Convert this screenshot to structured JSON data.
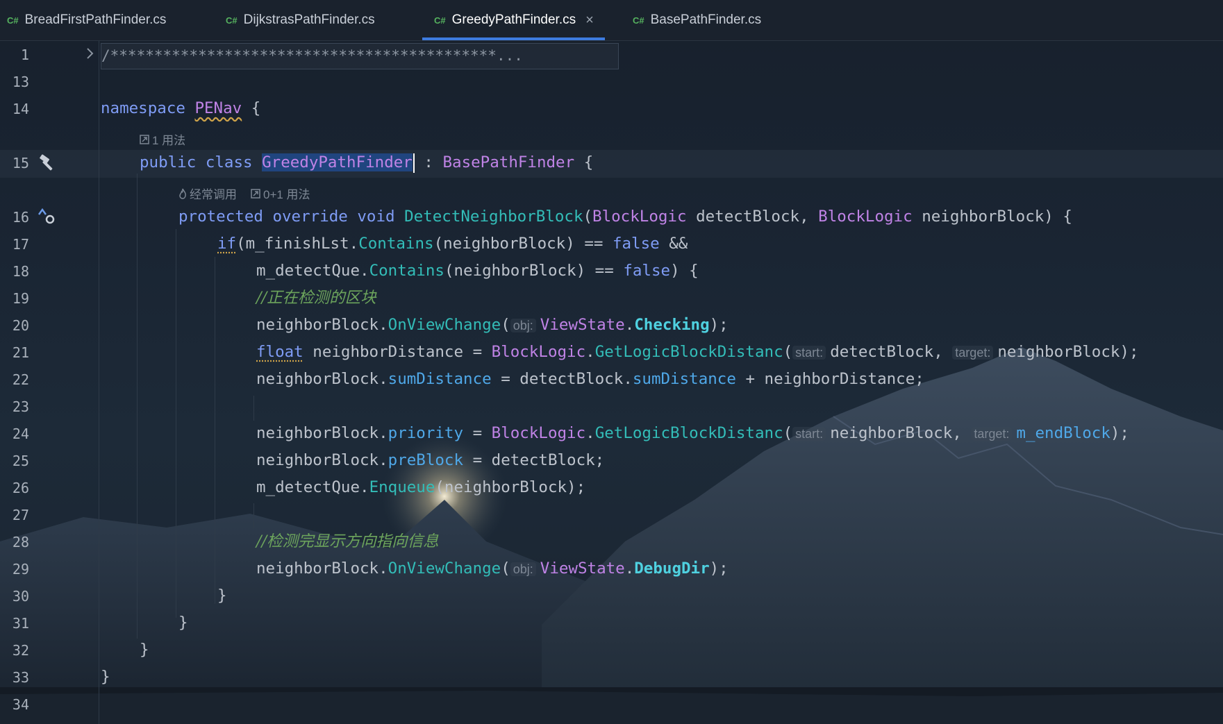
{
  "tabs": [
    {
      "lang": "C#",
      "name": "BreadFirstPathFinder.cs",
      "active": false
    },
    {
      "lang": "C#",
      "name": "DijkstrasPathFinder.cs",
      "active": false
    },
    {
      "lang": "C#",
      "name": "GreedyPathFinder.cs",
      "active": true,
      "close": "×"
    },
    {
      "lang": "C#",
      "name": "BasePathFinder.cs",
      "active": false
    }
  ],
  "line_numbers": [
    "1",
    "13",
    "14",
    "15",
    "16",
    "17",
    "18",
    "19",
    "20",
    "21",
    "22",
    "23",
    "24",
    "25",
    "26",
    "27",
    "28",
    "29",
    "30",
    "31",
    "32",
    "33",
    "34"
  ],
  "folded_header": "/********************************************...",
  "lenses": {
    "class_usage": "1 用法",
    "method_hot": "经常调用",
    "method_usage": "0+1 用法"
  },
  "code": {
    "l14_kw": "namespace",
    "l14_ns": "PENav",
    "l14_brace": "{",
    "l15_kw": "public class",
    "l15_cls": "GreedyPathFinder",
    "l15_colon": ":",
    "l15_base": "BasePathFinder",
    "l15_brace": "{",
    "l16_kw": "protected override void",
    "l16_fn": "DetectNeighborBlock",
    "l16_p1t": "BlockLogic",
    "l16_p1": "detectBlock,",
    "l16_p2t": "BlockLogic",
    "l16_p2": "neighborBlock) {",
    "l17_if": "if",
    "l17_a": "(m_finishLst.",
    "l17_fn": "Contains",
    "l17_b": "(neighborBlock) ==",
    "l17_false": "false",
    "l17_c": "&&",
    "l18_a": "m_detectQue.",
    "l18_fn": "Contains",
    "l18_b": "(neighborBlock) ==",
    "l18_false": "false",
    "l18_c": ") {",
    "l19_com": "//正在检测的区块",
    "l20_a": "neighborBlock.",
    "l20_fn": "OnViewChange",
    "l20_hint": "obj:",
    "l20_t": "ViewState",
    "l20_v": "Checking",
    "l20_end": ");",
    "l21_kw": "float",
    "l21_a": "neighborDistance =",
    "l21_t": "BlockLogic",
    "l21_fn": "GetLogicBlockDistanc",
    "l21_h1": "start:",
    "l21_p1": "detectBlock,",
    "l21_h2": "target:",
    "l21_p2": "neighborBlock);",
    "l22_a": "neighborBlock.",
    "l22_f": "sumDistance",
    "l22_b": "= detectBlock.",
    "l22_f2": "sumDistance",
    "l22_c": "+ neighborDistance;",
    "l24_a": "neighborBlock.",
    "l24_f": "priority",
    "l24_b": "=",
    "l24_t": "BlockLogic",
    "l24_fn": "GetLogicBlockDistanc",
    "l24_h1": "start:",
    "l24_p1": "neighborBlock,",
    "l24_h2": "target:",
    "l24_p2": "m_endBlock",
    "l24_end": ");",
    "l25_a": "neighborBlock.",
    "l25_f": "preBlock",
    "l25_b": "= detectBlock;",
    "l26_a": "m_detectQue.",
    "l26_fn": "Enqueue",
    "l26_b": "(neighborBlock);",
    "l28_com": "//检测完显示方向指向信息",
    "l29_a": "neighborBlock.",
    "l29_fn": "OnViewChange",
    "l29_hint": "obj:",
    "l29_t": "ViewState",
    "l29_v": "DebugDir",
    "l29_end": ");",
    "l30": "}",
    "l31": "}",
    "l32": "}",
    "l33": "}"
  },
  "colors": {
    "keyword": "#7f9cf5",
    "type": "#c083e6",
    "method": "#33bdb8",
    "field": "#4fa8e8",
    "comment": "#6da55c",
    "tab_underline": "#3d7bdf"
  }
}
